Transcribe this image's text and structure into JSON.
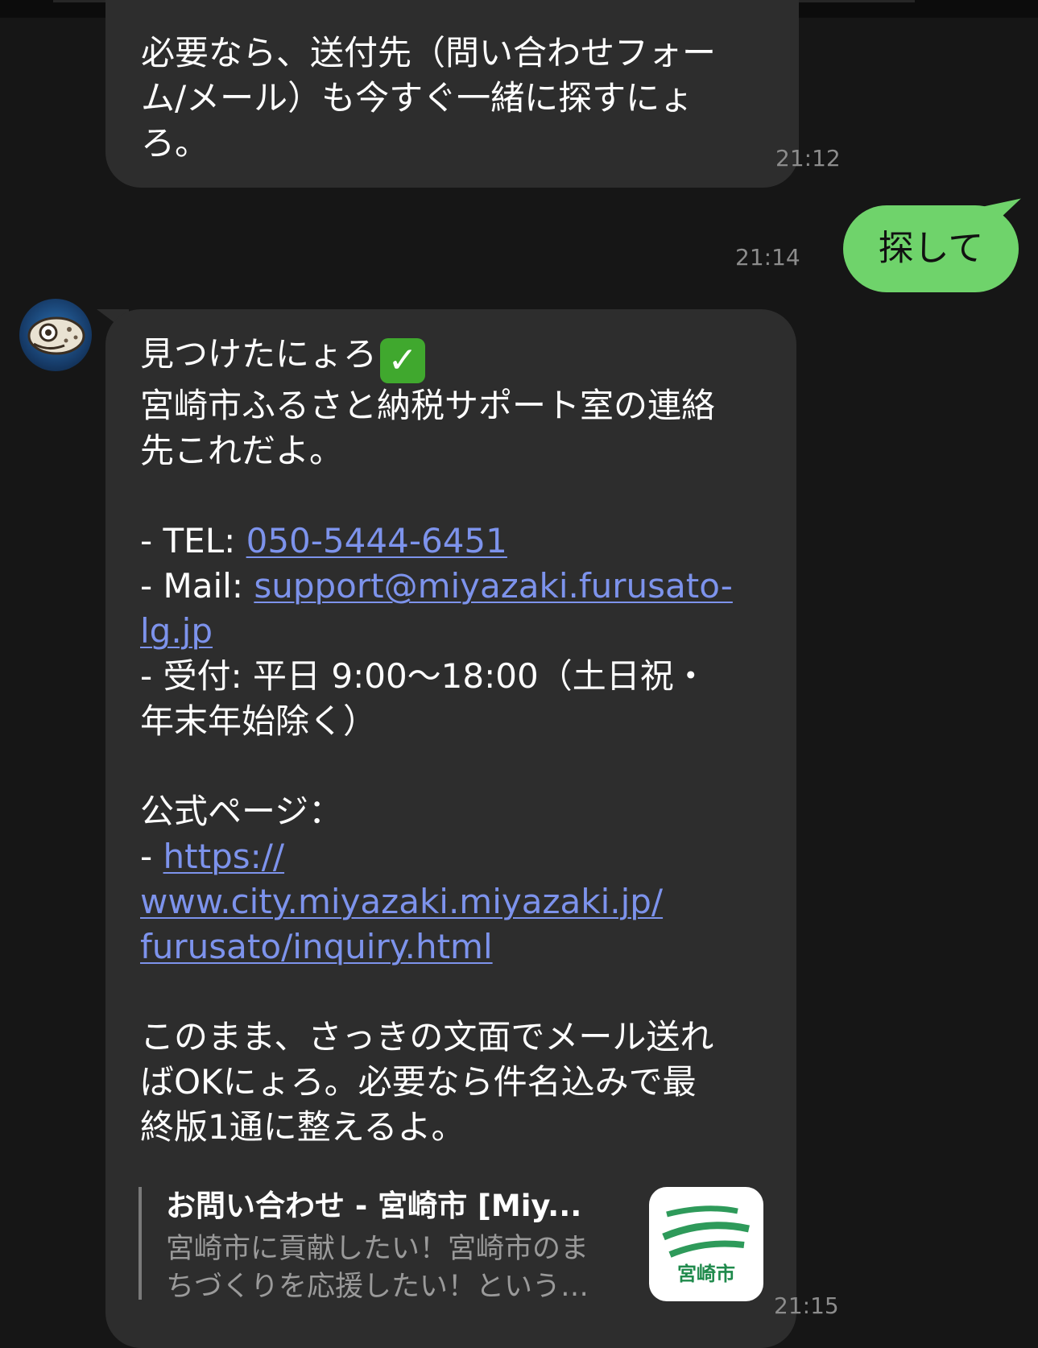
{
  "messages": {
    "m1": {
      "lines": [
        "必要なら、送付先（問い合わせフォー",
        "ム/メール）も今すぐ一緒に探すにょ",
        "ろ。"
      ],
      "time": "21:12"
    },
    "m2": {
      "text": "探して",
      "time": "21:14"
    },
    "m3": {
      "intro": [
        "見つけたにょろ",
        "宮崎市ふるさと納税サポート室の連絡",
        "先これだよ。"
      ],
      "tel_label": "- TEL: ",
      "tel": "050-5444-6451",
      "mail_label": "- Mail: ",
      "mail_1": "support@miyazaki.furusato-",
      "mail_2": "lg.jp",
      "hours_1": "- 受付: 平日 9:00～18:00（土日祝・",
      "hours_2": "年末年始除く）",
      "official_label": "公式ページ：",
      "url_prefix": "- ",
      "url_1": "https://",
      "url_2": "www.city.miyazaki.miyazaki.jp/",
      "url_3": "furusato/inquiry.html",
      "closing": [
        "このまま、さっきの文面でメール送れ",
        "ばOKにょろ。必要なら件名込みで最",
        "終版1通に整えるよ。"
      ],
      "time": "21:15"
    }
  },
  "link_preview": {
    "title": "お問い合わせ - 宮崎市 [Miy...",
    "desc_1": "宮崎市に貢献したい！宮崎市のま",
    "desc_2": "ちづくりを応援したい！という…",
    "thumb_label": "宮崎市"
  },
  "icons": {
    "check": "check-mark-emoji-icon",
    "avatar": "fish-avatar-icon"
  },
  "colors": {
    "bubble": "#2d2d2d",
    "sent_bubble": "#6fd36b",
    "link": "#7d93ec",
    "background": "#161616"
  }
}
